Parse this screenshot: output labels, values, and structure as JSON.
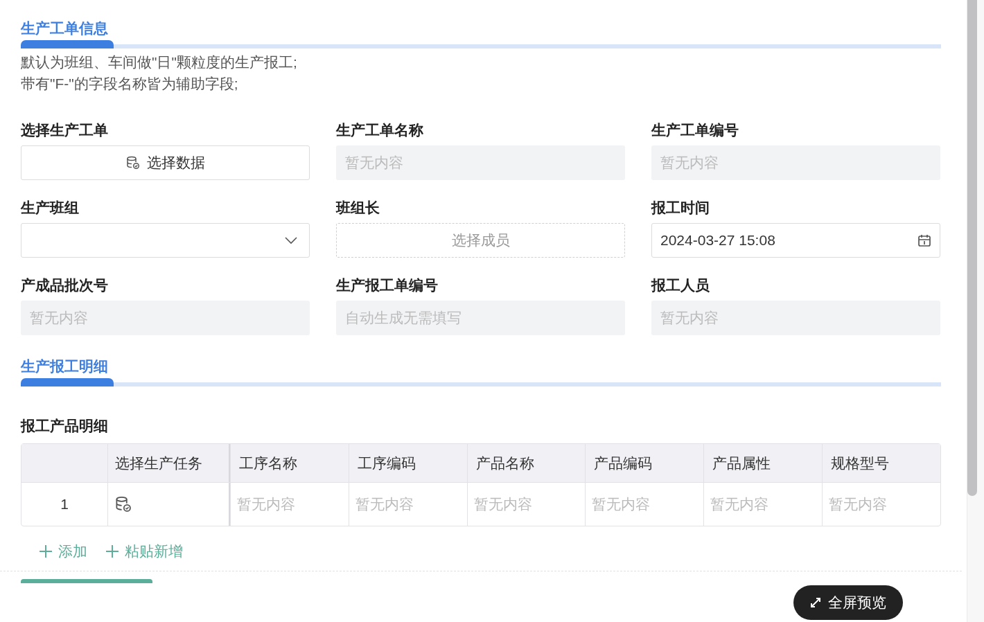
{
  "sections": [
    {
      "title": "生产工单信息",
      "notes": [
        "默认为班组、车间做\"日\"颗粒度的生产报工;",
        "带有\"F-\"的字段名称皆为辅助字段;"
      ],
      "fields": [
        {
          "label": "选择生产工单",
          "kind": "picker",
          "text": "选择数据"
        },
        {
          "label": "生产工单名称",
          "kind": "readonly",
          "placeholder": "暂无内容"
        },
        {
          "label": "生产工单编号",
          "kind": "readonly",
          "placeholder": "暂无内容"
        },
        {
          "label": "生产班组",
          "kind": "select"
        },
        {
          "label": "班组长",
          "kind": "member",
          "text": "选择成员"
        },
        {
          "label": "报工时间",
          "kind": "datetime",
          "value": "2024-03-27 15:08"
        },
        {
          "label": "产成品批次号",
          "kind": "readonly",
          "placeholder": "暂无内容"
        },
        {
          "label": "生产报工单编号",
          "kind": "readonly",
          "placeholder": "自动生成无需填写"
        },
        {
          "label": "报工人员",
          "kind": "readonly",
          "placeholder": "暂无内容"
        }
      ]
    },
    {
      "title": "生产报工明细",
      "table": {
        "title": "报工产品明细",
        "columns": [
          "",
          "选择生产任务",
          "工序名称",
          "工序编码",
          "产品名称",
          "产品编码",
          "产品属性",
          "规格型号"
        ],
        "rows": [
          {
            "cells": [
              "1",
              "",
              "暂无内容",
              "暂无内容",
              "暂无内容",
              "暂无内容",
              "暂无内容",
              "暂无内容"
            ]
          }
        ],
        "actions": [
          {
            "label": "添加"
          },
          {
            "label": "粘贴新增"
          }
        ]
      }
    }
  ],
  "fullscreen_button": {
    "label": "全屏预览"
  }
}
